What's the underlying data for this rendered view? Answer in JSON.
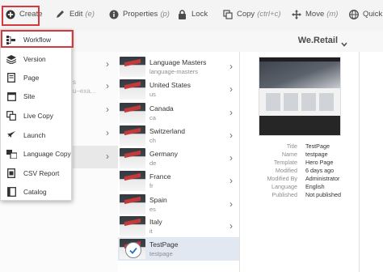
{
  "toolbar": {
    "create": "Create",
    "edit": "Edit",
    "edit_shortcut": "(e)",
    "properties": "Properties",
    "properties_shortcut": "(p)",
    "lock": "Lock",
    "copy": "Copy",
    "copy_shortcut": "(ctrl+c)",
    "move": "Move",
    "move_shortcut": "(m)",
    "quick_publish": "Quick P"
  },
  "header": {
    "site_title": "We.Retail"
  },
  "create_menu": {
    "items": [
      {
        "label": "Workflow",
        "icon": "workflow-icon"
      },
      {
        "label": "Version",
        "icon": "layers-icon"
      },
      {
        "label": "Page",
        "icon": "page-icon"
      },
      {
        "label": "Site",
        "icon": "site-icon"
      },
      {
        "label": "Live Copy",
        "icon": "live-copy-icon"
      },
      {
        "label": "Launch",
        "icon": "launch-icon"
      },
      {
        "label": "Language Copy",
        "icon": "language-copy-icon"
      },
      {
        "label": "CSV Report",
        "icon": "csv-icon"
      },
      {
        "label": "Catalog",
        "icon": "catalog-icon"
      }
    ]
  },
  "column1_ghost": {
    "a": "s",
    "b": "u–exa..."
  },
  "pages": [
    {
      "title": "Language Masters",
      "name": "language-masters"
    },
    {
      "title": "United States",
      "name": "us"
    },
    {
      "title": "Canada",
      "name": "ca"
    },
    {
      "title": "Switzerland",
      "name": "ch"
    },
    {
      "title": "Germany",
      "name": "de"
    },
    {
      "title": "France",
      "name": "fr"
    },
    {
      "title": "Spain",
      "name": "es"
    },
    {
      "title": "Italy",
      "name": "it"
    },
    {
      "title": "TestPage",
      "name": "testpage"
    }
  ],
  "metadata": {
    "rows": [
      {
        "label": "Title",
        "value": "TestPage"
      },
      {
        "label": "Name",
        "value": "testpage"
      },
      {
        "label": "Template",
        "value": "Hero Page"
      },
      {
        "label": "Modified",
        "value": "6 days ago"
      },
      {
        "label": "Modified By",
        "value": "Administrator"
      },
      {
        "label": "Language",
        "value": "English"
      },
      {
        "label": "Published",
        "value": "Not published"
      }
    ]
  },
  "colors": {
    "highlight": "#d7373f",
    "selected_row": "#e1e8f2"
  }
}
